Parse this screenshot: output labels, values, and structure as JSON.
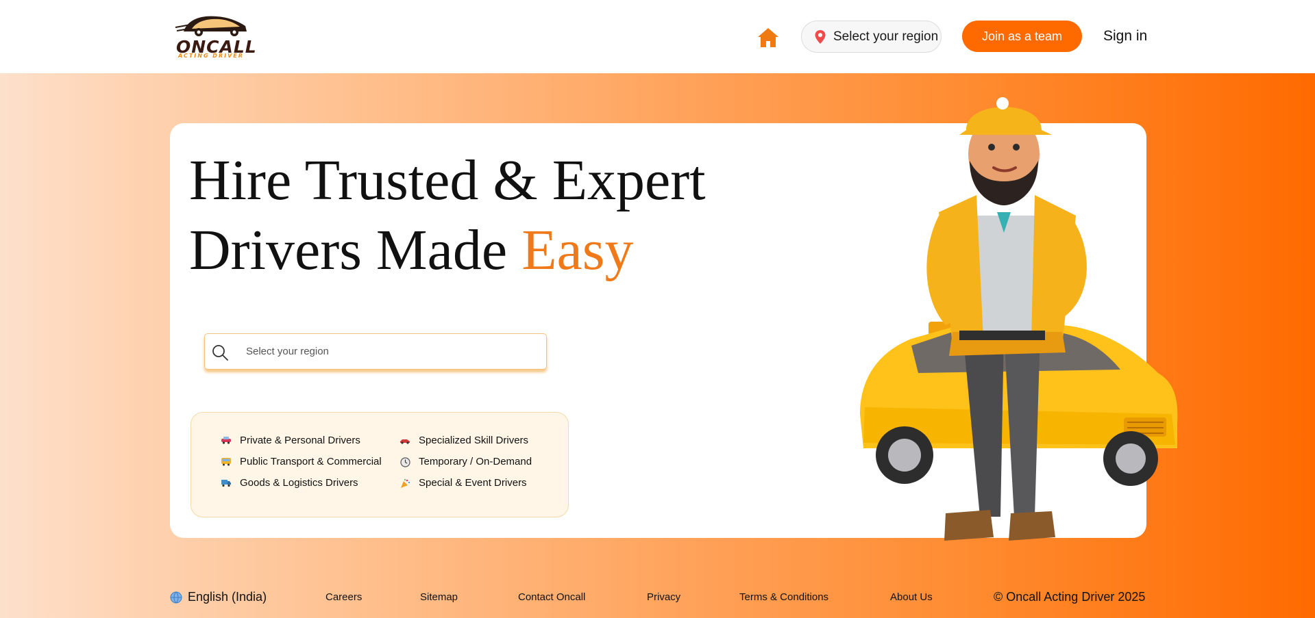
{
  "brand": {
    "name": "ONCALL",
    "tagline": "ACTING DRIVER",
    "accent": "#ff6a00",
    "text_accent": "#f07a1a"
  },
  "header": {
    "home_icon": "home-icon",
    "region_label": "Select your region",
    "join_label": "Join as a team",
    "signin_label": "Sign in"
  },
  "hero": {
    "headline_line1": "Hire Trusted & Expert",
    "headline_line2_plain": "Drivers Made ",
    "headline_line2_accent": "Easy",
    "search_placeholder": "Select your region"
  },
  "categories": [
    {
      "label": "Private & Personal Drivers",
      "icon": "car-icon"
    },
    {
      "label": "Specialized Skill Drivers",
      "icon": "race-car-icon"
    },
    {
      "label": "Public Transport & Commercial",
      "icon": "bus-icon"
    },
    {
      "label": "Temporary / On-Demand",
      "icon": "clock-icon"
    },
    {
      "label": "Goods & Logistics Drivers",
      "icon": "truck-icon"
    },
    {
      "label": "Special & Event Drivers",
      "icon": "party-popper-icon"
    }
  ],
  "footer": {
    "language": "English (India)",
    "links": [
      "Careers",
      "Sitemap",
      "Contact Oncall",
      "Privacy",
      "Terms & Conditions",
      "About Us"
    ],
    "copyright": "© Oncall Acting Driver 2025"
  }
}
